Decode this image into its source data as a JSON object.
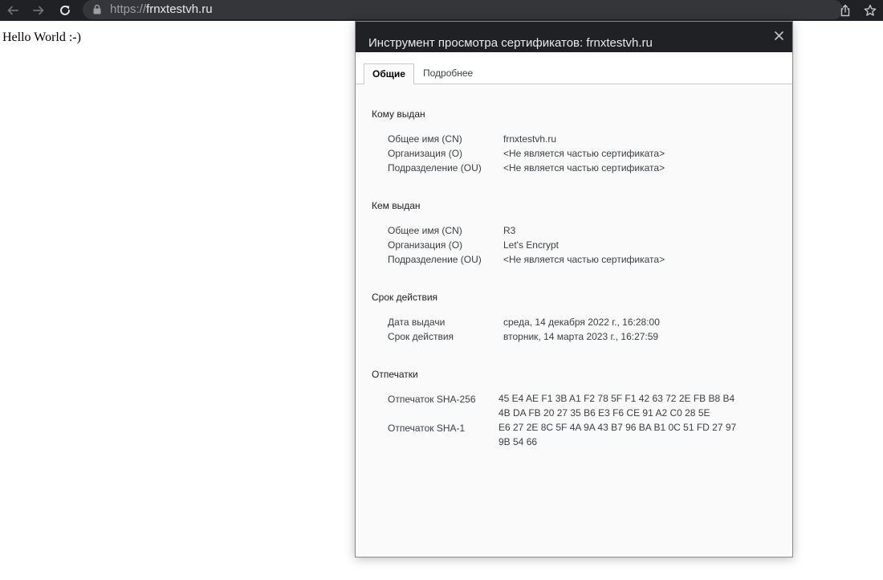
{
  "browser": {
    "url_scheme": "https://",
    "url_host": "frnxtestvh.ru"
  },
  "page": {
    "body_text": "Hello World :-)"
  },
  "dialog": {
    "title": "Инструмент просмотра сертификатов: frnxtestvh.ru",
    "tabs": [
      {
        "label": "Общие",
        "active": true
      },
      {
        "label": "Подробнее",
        "active": false
      }
    ],
    "issued_to": {
      "title": "Кому выдан",
      "fields": [
        {
          "label": "Общее имя (CN)",
          "value": "frnxtestvh.ru"
        },
        {
          "label": "Организация (O)",
          "value": "<Не является частью сертификата>"
        },
        {
          "label": "Подразделение (OU)",
          "value": "<Не является частью сертификата>"
        }
      ]
    },
    "issued_by": {
      "title": "Кем выдан",
      "fields": [
        {
          "label": "Общее имя (CN)",
          "value": "R3"
        },
        {
          "label": "Организация (O)",
          "value": "Let's Encrypt"
        },
        {
          "label": "Подразделение (OU)",
          "value": "<Не является частью сертификата>"
        }
      ]
    },
    "validity": {
      "title": "Срок действия",
      "fields": [
        {
          "label": "Дата выдачи",
          "value": "среда, 14 декабря 2022 г., 16:28:00"
        },
        {
          "label": "Срок действия",
          "value": "вторник, 14 марта 2023 г., 16:27:59"
        }
      ]
    },
    "fingerprints": {
      "title": "Отпечатки",
      "fields": [
        {
          "label": "Отпечаток SHA-256",
          "value": "45 E4 AE F1 3B A1 F2 78 5F F1 42 63 72 2E FB B8 B4 4B DA FB 20 27 35 B6 E3 F6 CE 91 A2 C0 28 5E"
        },
        {
          "label": "Отпечаток SHA-1",
          "value": "E6 27 2E 8C 5F 4A 9A 43 B7 96 BA B1 0C 51 FD 27 97 9B 54 66"
        }
      ]
    }
  }
}
